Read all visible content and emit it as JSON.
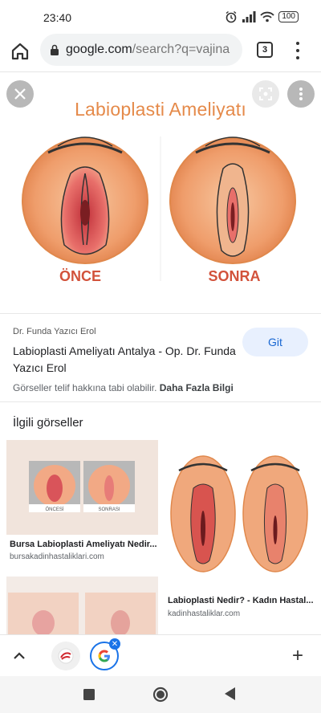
{
  "status": {
    "time": "23:40",
    "battery": "100"
  },
  "browser": {
    "url_host": "google.com",
    "url_path": "/search?q=vajina",
    "tab_count": "3"
  },
  "viewer": {
    "image_title": "Labioplasti Ameliyatı",
    "label_before": "ÖNCE",
    "label_after": "SONRA"
  },
  "info": {
    "source": "Dr. Funda Yazıcı Erol",
    "title": "Labioplasti Ameliyatı Antalya - Op. Dr. Funda Yazıcı Erol",
    "copyright_text": "Görseller telif hakkına tabi olabilir.",
    "copyright_link": "Daha Fazla Bilgi",
    "go_label": "Git"
  },
  "related": {
    "heading": "İlgili görseller",
    "cards": [
      {
        "title": "Bursa Labioplasti Ameliyatı Nedir...",
        "source": "bursakadinhastaliklari.com",
        "caption_left": "ÖNCESİ",
        "caption_right": "SONRASI"
      },
      {
        "title": "Labioplasti Nedir? - Kadın Hastal...",
        "source": "kadinhastaliklar.com"
      }
    ]
  },
  "colors": {
    "accent": "#1a73e8",
    "title_orange": "#e58a4a",
    "label_red": "#d2523b"
  }
}
